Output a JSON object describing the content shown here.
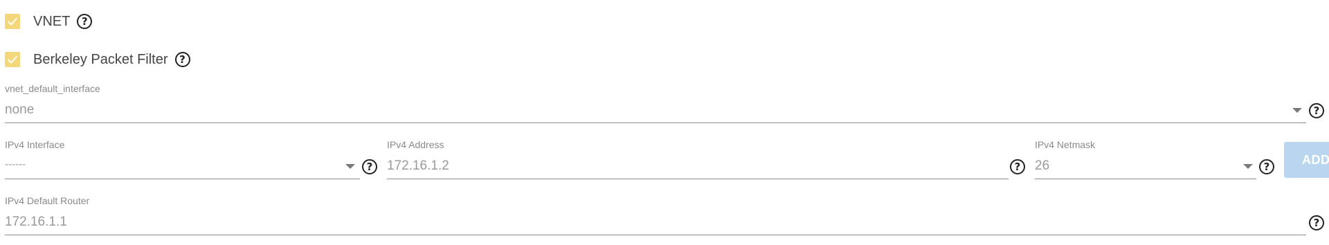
{
  "checkboxes": [
    {
      "label": "VNET",
      "checked": true
    },
    {
      "label": "Berkeley Packet Filter",
      "checked": true
    }
  ],
  "vnet_default_interface": {
    "label": "vnet_default_interface",
    "value": "none"
  },
  "ipv4_interface": {
    "label": "IPv4 Interface",
    "value": "------"
  },
  "ipv4_address": {
    "label": "IPv4 Address",
    "value": "172.16.1.2"
  },
  "ipv4_netmask": {
    "label": "IPv4 Netmask",
    "value": "26"
  },
  "add_button": {
    "label": "ADD"
  },
  "ipv4_default_router": {
    "label": "IPv4 Default Router",
    "value": "172.16.1.1"
  },
  "help_glyph": "?",
  "icons": [
    "checkmark-icon",
    "help-circle-icon",
    "dropdown-caret-icon"
  ],
  "colors": {
    "checkbox_fill": "#f4d77a",
    "checkbox_check": "#ffffff",
    "button_fill": "#b9d6ee",
    "underline": "#8c8c8c",
    "label_text": "#8a8a8a",
    "value_text": "#9a9a9a"
  }
}
